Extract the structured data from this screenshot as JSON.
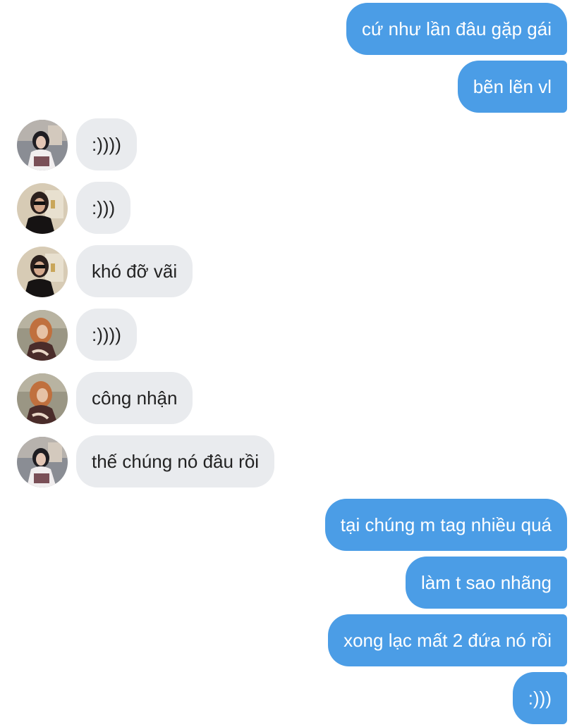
{
  "colors": {
    "outgoing_bubble": "#4b9de6",
    "incoming_bubble": "#e9ebee",
    "outgoing_text": "#ffffff",
    "incoming_text": "#222222"
  },
  "messages": [
    {
      "direction": "out",
      "text": "cứ như lần đâu gặp gái"
    },
    {
      "direction": "out",
      "text": "bẽn lẽn vl"
    },
    {
      "direction": "in",
      "sender_avatar": "avatar-1",
      "text": ":))))"
    },
    {
      "direction": "in",
      "sender_avatar": "avatar-2",
      "text": ":)))"
    },
    {
      "direction": "in",
      "sender_avatar": "avatar-2",
      "text": "khó đỡ vãi"
    },
    {
      "direction": "in",
      "sender_avatar": "avatar-3",
      "text": ":))))"
    },
    {
      "direction": "in",
      "sender_avatar": "avatar-3",
      "text": "công nhận"
    },
    {
      "direction": "in",
      "sender_avatar": "avatar-1",
      "text": "thế chúng nó đâu rồi"
    },
    {
      "direction": "out",
      "text": "tại chúng m tag nhiều quá"
    },
    {
      "direction": "out",
      "text": "làm t sao nhãng"
    },
    {
      "direction": "out",
      "text": "xong lạc mất 2 đứa nó rồi"
    },
    {
      "direction": "out",
      "text": ":)))"
    }
  ]
}
